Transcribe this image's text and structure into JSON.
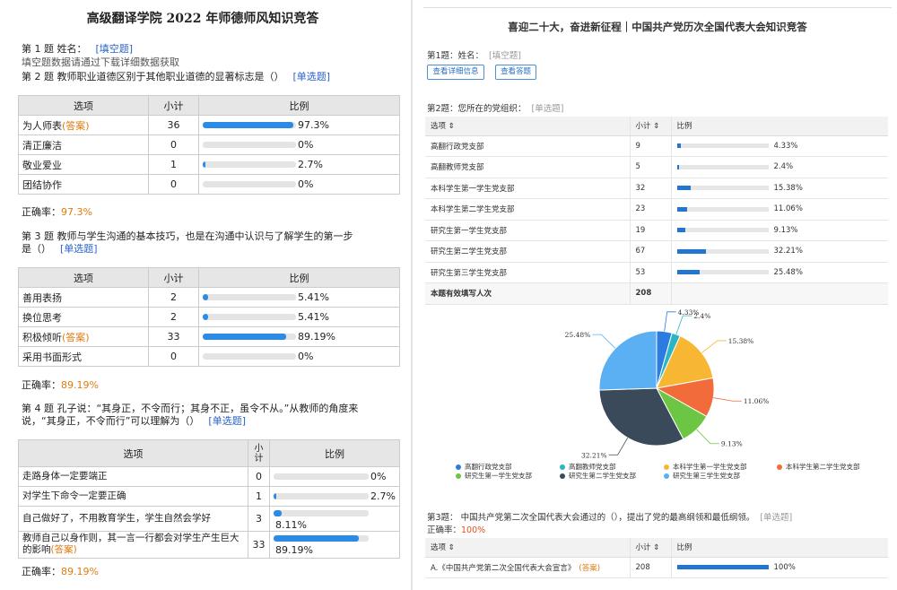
{
  "left": {
    "title": "高级翻译学院 2022 年师德师风知识竞答",
    "q1": {
      "label": "第 1 题  姓名：",
      "tag": "[填空题]",
      "note": "填空题数据请通过下载详细数据获取"
    },
    "q2": {
      "label": "第 2 题  教师职业道德区别于其他职业道德的显著标志是（）",
      "tag": "[单选题]",
      "headers": [
        "选项",
        "小计",
        "比例"
      ],
      "rows": [
        {
          "option": "为人师表",
          "answer_tag": "(答案)",
          "count": "36",
          "pct": "97.3%",
          "ratio": 0.973
        },
        {
          "option": "清正廉洁",
          "answer_tag": "",
          "count": "0",
          "pct": "0%",
          "ratio": 0
        },
        {
          "option": "敬业爱业",
          "answer_tag": "",
          "count": "1",
          "pct": "2.7%",
          "ratio": 0.027
        },
        {
          "option": "团结协作",
          "answer_tag": "",
          "count": "0",
          "pct": "0%",
          "ratio": 0
        }
      ],
      "acc_label": "正确率：",
      "acc": "97.3%"
    },
    "q3": {
      "line1": "第 3 题  教师与学生沟通的基本技巧，也是在沟通中认识与了解学生的第一步",
      "line2": "是（）",
      "tag": "[单选题]",
      "headers": [
        "选项",
        "小计",
        "比例"
      ],
      "rows": [
        {
          "option": "善用表扬",
          "answer_tag": "",
          "count": "2",
          "pct": "5.41%",
          "ratio": 0.0541
        },
        {
          "option": "换位思考",
          "answer_tag": "",
          "count": "2",
          "pct": "5.41%",
          "ratio": 0.0541
        },
        {
          "option": "积极倾听",
          "answer_tag": "(答案)",
          "count": "33",
          "pct": "89.19%",
          "ratio": 0.8919
        },
        {
          "option": "采用书面形式",
          "answer_tag": "",
          "count": "0",
          "pct": "0%",
          "ratio": 0
        }
      ],
      "acc_label": "正确率：",
      "acc": "89.19%"
    },
    "q4": {
      "line1": "第 4 题  孔子说：“其身正，不令而行；其身不正，虽令不从。”从教师的角度来",
      "line2": "说，“其身正，不令而行”可以理解为（）",
      "tag": "[单选题]",
      "headers": [
        "选项",
        "小\n计",
        "比例"
      ],
      "rows": [
        {
          "option": "走路身体一定要端正",
          "answer_tag": "",
          "count": "0",
          "pct": "0%",
          "ratio": 0
        },
        {
          "option": "对学生下命令一定要正确",
          "answer_tag": "",
          "count": "1",
          "pct": "2.7%",
          "ratio": 0.027
        },
        {
          "option": "自己做好了，不用教育学生，学生自然会学好",
          "answer_tag": "",
          "count": "3",
          "pct": "8.11%",
          "ratio": 0.0811
        },
        {
          "option": "教师自己以身作则，其一言一行都会对学生产生巨大的影响",
          "answer_tag": "(答案)",
          "count": "33",
          "pct": "89.19%",
          "ratio": 0.8919
        }
      ],
      "acc_label": "正确率：",
      "acc": "89.19%"
    }
  },
  "right": {
    "title": "喜迎二十大，奋进新征程｜中国共产党历次全国代表大会知识竞答",
    "q1": {
      "label": "第1题：姓名：",
      "tag": "[填空题]"
    },
    "buttons": [
      "查看详细信息",
      "查看答题"
    ],
    "q2": {
      "label": "第2题：您所在的党组织：",
      "tag": "[单选题]",
      "headers": [
        "选项 ⇕",
        "小计 ⇕",
        "比例"
      ],
      "rows": [
        {
          "option": "高翻行政党支部",
          "count": "9",
          "pct": "4.33%",
          "ratio": 0.0433
        },
        {
          "option": "高翻教师党支部",
          "count": "5",
          "pct": "2.4%",
          "ratio": 0.024
        },
        {
          "option": "本科学生第一学生党支部",
          "count": "32",
          "pct": "15.38%",
          "ratio": 0.1538
        },
        {
          "option": "本科学生第二学生党支部",
          "count": "23",
          "pct": "11.06%",
          "ratio": 0.1106
        },
        {
          "option": "研究生第一学生党支部",
          "count": "19",
          "pct": "9.13%",
          "ratio": 0.0913
        },
        {
          "option": "研究生第二学生党支部",
          "count": "67",
          "pct": "32.21%",
          "ratio": 0.3221
        },
        {
          "option": "研究生第三学生党支部",
          "count": "53",
          "pct": "25.48%",
          "ratio": 0.2548
        }
      ],
      "total_label": "本题有效填写人次",
      "total": "208"
    },
    "chart_data": {
      "type": "pie",
      "labels": [
        "高翻行政党支部",
        "高翻教师党支部",
        "本科学生第一学生党支部",
        "本科学生第二学生党支部",
        "研究生第一学生党支部",
        "研究生第二学生党支部",
        "研究生第三学生党支部"
      ],
      "values": [
        4.33,
        2.4,
        15.38,
        11.06,
        9.13,
        32.21,
        25.48
      ],
      "value_labels": [
        "4.33%",
        "2.4%",
        "15.38%",
        "11.06%",
        "9.13%",
        "32.21%",
        "25.48%"
      ],
      "colors": [
        "#2c7be0",
        "#2bb5c4",
        "#f7b733",
        "#f26b3a",
        "#6cc644",
        "#3b4a5a",
        "#5ab0f2"
      ],
      "legend_position": "bottom"
    },
    "q3": {
      "label": "第3题：  中国共产党第二次全国代表大会通过的（），提出了党的最高纲领和最低纲领。",
      "tag": "[单选题]",
      "acc_label": "正确率：",
      "acc": "100%",
      "headers": [
        "选项 ⇕",
        "小计 ⇕",
        "比例"
      ],
      "rows": [
        {
          "option": "A.《中国共产党第二次全国代表大会宣言》",
          "answer_tag": "(答案)",
          "count": "208",
          "pct": "100%",
          "ratio": 1.0
        }
      ]
    }
  }
}
